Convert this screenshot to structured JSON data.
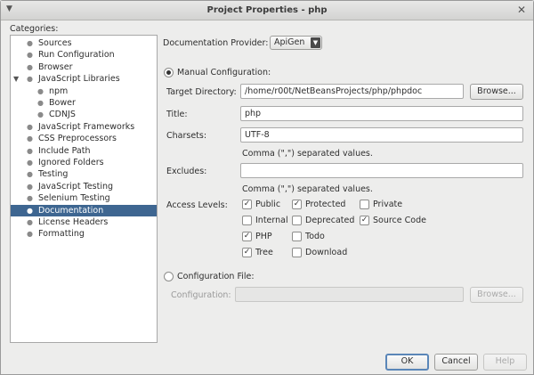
{
  "window": {
    "title": "Project Properties - php",
    "menu_icon": "chevron-down-icon",
    "close_icon": "close-icon"
  },
  "categories": {
    "label": "Categories:",
    "items": [
      {
        "label": "Sources",
        "depth": 1
      },
      {
        "label": "Run Configuration",
        "depth": 1
      },
      {
        "label": "Browser",
        "depth": 1
      },
      {
        "label": "JavaScript Libraries",
        "depth": 1,
        "expanded": true
      },
      {
        "label": "npm",
        "depth": 2
      },
      {
        "label": "Bower",
        "depth": 2
      },
      {
        "label": "CDNJS",
        "depth": 2
      },
      {
        "label": "JavaScript Frameworks",
        "depth": 1
      },
      {
        "label": "CSS Preprocessors",
        "depth": 1
      },
      {
        "label": "Include Path",
        "depth": 1
      },
      {
        "label": "Ignored Folders",
        "depth": 1
      },
      {
        "label": "Testing",
        "depth": 1
      },
      {
        "label": "JavaScript Testing",
        "depth": 1
      },
      {
        "label": "Selenium Testing",
        "depth": 1
      },
      {
        "label": "Documentation",
        "depth": 1,
        "selected": true
      },
      {
        "label": "License Headers",
        "depth": 1
      },
      {
        "label": "Formatting",
        "depth": 1
      }
    ]
  },
  "provider": {
    "label": "Documentation Provider:",
    "value": "ApiGen"
  },
  "manual": {
    "label": "Manual Configuration:",
    "selected": true,
    "target_dir_label": "Target Directory:",
    "target_dir_value": "/home/r00t/NetBeansProjects/php/phpdoc",
    "browse_label": "Browse...",
    "title_label": "Title:",
    "title_value": "php",
    "charsets_label": "Charsets:",
    "charsets_value": "UTF-8",
    "charsets_hint": "Comma (\",\") separated values.",
    "excludes_label": "Excludes:",
    "excludes_value": "",
    "excludes_hint": "Comma (\",\") separated values.",
    "access_label": "Access Levels:",
    "options": {
      "public": {
        "label": "Public",
        "checked": true
      },
      "protected": {
        "label": "Protected",
        "checked": true
      },
      "private": {
        "label": "Private",
        "checked": false
      },
      "internal": {
        "label": "Internal",
        "checked": false
      },
      "deprecated": {
        "label": "Deprecated",
        "checked": false
      },
      "source_code": {
        "label": "Source Code",
        "checked": true
      },
      "php": {
        "label": "PHP",
        "checked": true
      },
      "todo": {
        "label": "Todo",
        "checked": false
      },
      "tree": {
        "label": "Tree",
        "checked": true
      },
      "download": {
        "label": "Download",
        "checked": false
      }
    }
  },
  "config_file": {
    "label": "Configuration File:",
    "selected": false,
    "config_label": "Configuration:",
    "config_value": "",
    "browse_label": "Browse..."
  },
  "buttons": {
    "ok": "OK",
    "cancel": "Cancel",
    "help": "Help"
  }
}
